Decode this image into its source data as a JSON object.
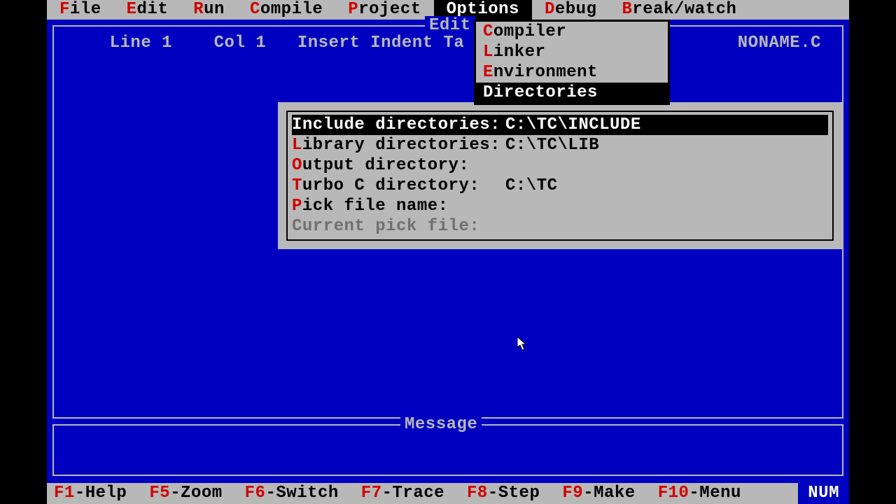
{
  "menubar": {
    "items": [
      {
        "hk": "F",
        "rest": "ile"
      },
      {
        "hk": "E",
        "rest": "dit"
      },
      {
        "hk": "R",
        "rest": "un"
      },
      {
        "hk": "C",
        "rest": "ompile"
      },
      {
        "hk": "P",
        "rest": "roject"
      },
      {
        "hk": "O",
        "rest": "ptions",
        "selected": true
      },
      {
        "hk": "D",
        "rest": "ebug"
      },
      {
        "hk": "B",
        "rest": "reak/watch"
      }
    ]
  },
  "editor": {
    "title": "Edit",
    "status": "    Line 1    Col 1   Insert Indent Ta",
    "filename": "NONAME.C",
    "message_title": "Message"
  },
  "options_menu": {
    "items": [
      {
        "hk": "C",
        "rest": "ompiler"
      },
      {
        "hk": "L",
        "rest": "inker"
      },
      {
        "hk": "E",
        "rest": "nvironment"
      },
      {
        "hk": "D",
        "rest": "irectories",
        "selected": true
      }
    ]
  },
  "directories_dialog": {
    "rows": [
      {
        "hk": "I",
        "rest": "nclude directories:",
        "value": "C:\\TC\\INCLUDE",
        "selected": true
      },
      {
        "hk": "L",
        "rest": "ibrary directories:",
        "value": "C:\\TC\\LIB"
      },
      {
        "hk": "O",
        "rest": "utput directory:",
        "value": ""
      },
      {
        "hk": "T",
        "rest": "urbo C directory:",
        "value": "C:\\TC"
      },
      {
        "hk": "P",
        "rest": "ick file name:",
        "value": ""
      },
      {
        "hk": "",
        "rest": "Current pick file:",
        "value": "",
        "disabled": true
      }
    ]
  },
  "fnbar": {
    "items": [
      {
        "key": "F1",
        "label": "-Help"
      },
      {
        "key": "F5",
        "label": "-Zoom"
      },
      {
        "key": "F6",
        "label": "-Switch"
      },
      {
        "key": "F7",
        "label": "-Trace"
      },
      {
        "key": "F8",
        "label": "-Step"
      },
      {
        "key": "F9",
        "label": "-Make"
      },
      {
        "key": "F10",
        "label": "-Menu"
      }
    ],
    "indicator": "NUM"
  }
}
